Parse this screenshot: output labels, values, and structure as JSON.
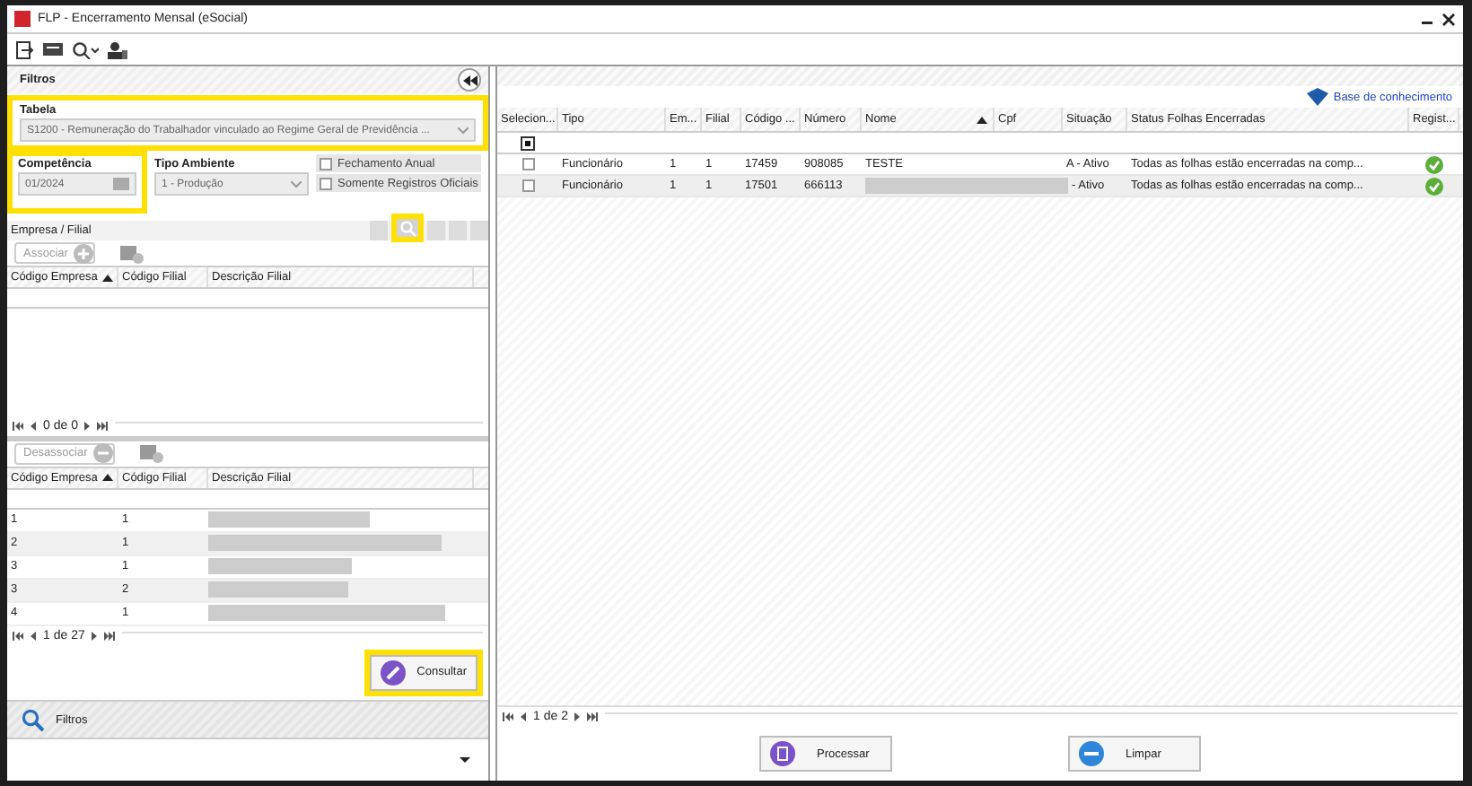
{
  "window": {
    "title": "FLP - Encerramento Mensal (eSocial)"
  },
  "filters": {
    "title": "Filtros",
    "tabela": {
      "label": "Tabela",
      "value": "S1200 - Remuneração do Trabalhador vinculado ao Regime Geral de Previdência ...",
      "highlighted": true
    },
    "competencia": {
      "label": "Competência",
      "value": "01/2024",
      "highlighted": true
    },
    "tipo_ambiente": {
      "label": "Tipo Ambiente",
      "value": "1 - Produção"
    },
    "options": [
      {
        "label": "Fechamento Anual",
        "checked": false
      },
      {
        "label": "Somente Registros Oficiais",
        "checked": false
      }
    ],
    "section_title": "Empresa / Filial",
    "search_highlighted": true,
    "associar": "Associar",
    "available_columns": [
      "Código Empresa",
      "Código Filial",
      "Descrição Filial"
    ],
    "available_pager": "0 de 0",
    "desassociar": "Desassociar",
    "selected_columns": [
      "Código Empresa",
      "Código Filial",
      "Descrição Filial"
    ],
    "selected_rows": [
      {
        "empresa": "1",
        "filial": "1"
      },
      {
        "empresa": "2",
        "filial": "1"
      },
      {
        "empresa": "3",
        "filial": "1"
      },
      {
        "empresa": "3",
        "filial": "2"
      },
      {
        "empresa": "4",
        "filial": "1"
      }
    ],
    "selected_pager": "1 de 27",
    "consultar": "Consultar",
    "consultar_highlighted": true,
    "footer": "Filtros"
  },
  "results": {
    "link": "Base de conhecimento",
    "columns": [
      "Selecion...",
      "Tipo",
      "Em...",
      "Filial",
      "Código ...",
      "Número",
      "Nome",
      "Cpf",
      "Situação",
      "Status Folhas Encerradas",
      "Regist..."
    ],
    "select_all": {
      "checked": true
    },
    "rows": [
      {
        "selected": false,
        "cells": [
          "",
          "Funcionário",
          "1",
          "1",
          "17459",
          "908085",
          "TESTE",
          "",
          "A - Ativo",
          "Todas as folhas estão encerradas na comp...",
          ""
        ]
      },
      {
        "selected": false,
        "cells": [
          "",
          "Funcionário",
          "1",
          "1",
          "17501",
          "666113",
          "",
          "",
          "- Ativo",
          "Todas as folhas estão encerradas na comp...",
          ""
        ]
      }
    ],
    "pager": "1 de 2",
    "buttons": [
      "Processar",
      "Limpar"
    ]
  }
}
